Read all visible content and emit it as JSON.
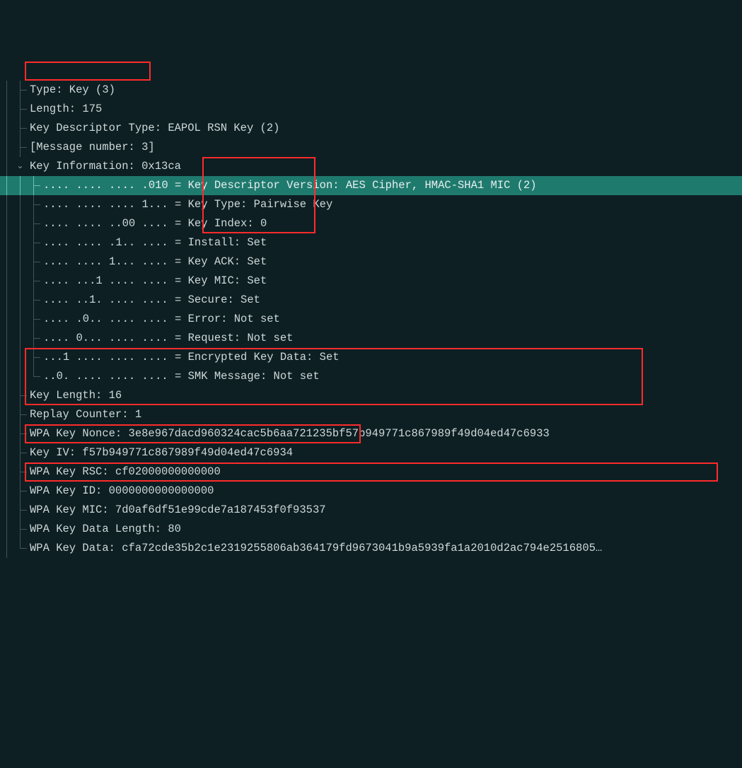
{
  "rows": [
    {
      "depth": 2,
      "guides": [
        "v",
        "h"
      ],
      "type": "item",
      "text": "Type: Key (3)"
    },
    {
      "depth": 2,
      "guides": [
        "v",
        "h"
      ],
      "type": "item",
      "text": "Length: 175"
    },
    {
      "depth": 2,
      "guides": [
        "v",
        "h"
      ],
      "type": "item",
      "text": "Key Descriptor Type: EAPOL RSN Key (2)"
    },
    {
      "depth": 2,
      "guides": [
        "v",
        "h"
      ],
      "type": "item",
      "text": "[Message number: 3]"
    },
    {
      "depth": 2,
      "guides": [
        "v",
        "arrow-down"
      ],
      "type": "expander",
      "text": "Key Information: 0x13ca"
    },
    {
      "depth": 3,
      "guides": [
        "v",
        "v",
        "h"
      ],
      "type": "item",
      "selected": true,
      "text": ".... .... .... .010 = Key Descriptor Version: AES Cipher, HMAC-SHA1 MIC (2)"
    },
    {
      "depth": 3,
      "guides": [
        "v",
        "v",
        "h"
      ],
      "type": "item",
      "text": ".... .... .... 1... = Key Type: Pairwise Key"
    },
    {
      "depth": 3,
      "guides": [
        "v",
        "v",
        "h"
      ],
      "type": "item",
      "text": ".... .... ..00 .... = Key Index: 0"
    },
    {
      "depth": 3,
      "guides": [
        "v",
        "v",
        "h"
      ],
      "type": "item",
      "text": ".... .... .1.. .... = Install: Set"
    },
    {
      "depth": 3,
      "guides": [
        "v",
        "v",
        "h"
      ],
      "type": "item",
      "text": ".... .... 1... .... = Key ACK: Set"
    },
    {
      "depth": 3,
      "guides": [
        "v",
        "v",
        "h"
      ],
      "type": "item",
      "text": ".... ...1 .... .... = Key MIC: Set"
    },
    {
      "depth": 3,
      "guides": [
        "v",
        "v",
        "h"
      ],
      "type": "item",
      "text": ".... ..1. .... .... = Secure: Set"
    },
    {
      "depth": 3,
      "guides": [
        "v",
        "v",
        "h"
      ],
      "type": "item",
      "text": ".... .0.. .... .... = Error: Not set"
    },
    {
      "depth": 3,
      "guides": [
        "v",
        "v",
        "h"
      ],
      "type": "item",
      "text": ".... 0... .... .... = Request: Not set"
    },
    {
      "depth": 3,
      "guides": [
        "v",
        "v",
        "h"
      ],
      "type": "item",
      "text": "...1 .... .... .... = Encrypted Key Data: Set"
    },
    {
      "depth": 3,
      "guides": [
        "v",
        "v",
        "t"
      ],
      "type": "item",
      "text": "..0. .... .... .... = SMK Message: Not set"
    },
    {
      "depth": 2,
      "guides": [
        "v",
        "h"
      ],
      "type": "item",
      "text": "Key Length: 16"
    },
    {
      "depth": 2,
      "guides": [
        "v",
        "h"
      ],
      "type": "item",
      "text": "Replay Counter: 1"
    },
    {
      "depth": 2,
      "guides": [
        "v",
        "h"
      ],
      "type": "item",
      "text": "WPA Key Nonce: 3e8e967dacd960324cac5b6aa721235bf57b949771c867989f49d04ed47c6933"
    },
    {
      "depth": 2,
      "guides": [
        "v",
        "h"
      ],
      "type": "item",
      "text": "Key IV: f57b949771c867989f49d04ed47c6934"
    },
    {
      "depth": 2,
      "guides": [
        "v",
        "h"
      ],
      "type": "item",
      "text": "WPA Key RSC: cf02000000000000"
    },
    {
      "depth": 2,
      "guides": [
        "v",
        "h"
      ],
      "type": "item",
      "text": "WPA Key ID: 0000000000000000"
    },
    {
      "depth": 2,
      "guides": [
        "v",
        "h"
      ],
      "type": "item",
      "text": "WPA Key MIC: 7d0af6df51e99cde7a187453f0f93537"
    },
    {
      "depth": 2,
      "guides": [
        "v",
        "h"
      ],
      "type": "item",
      "text": "WPA Key Data Length: 80"
    },
    {
      "depth": 2,
      "guides": [
        "v",
        "t"
      ],
      "type": "item",
      "text": "WPA Key Data: cfa72cde35b2c1e2319255806ab364179fd9673041b9a5939fa1a2010d2ac794e2516805…"
    }
  ]
}
